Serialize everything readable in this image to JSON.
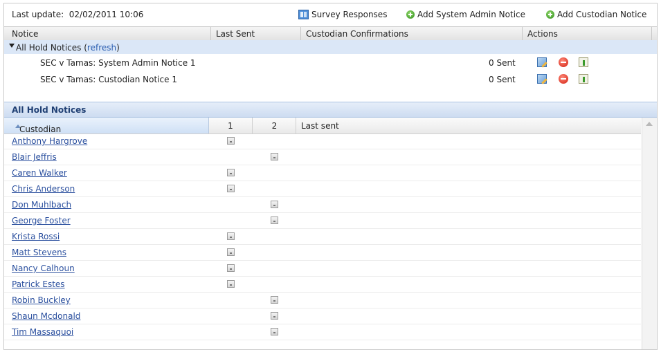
{
  "topbar": {
    "last_update_label": "Last update:",
    "last_update_value": "02/02/2011 10:06",
    "survey_responses": "Survey Responses",
    "add_system_admin_notice": "Add System Admin Notice",
    "add_custodian_notice": "Add Custodian Notice"
  },
  "notices_table": {
    "columns": [
      "Notice",
      "Last Sent",
      "Custodian Confirmations",
      "Actions"
    ],
    "group": {
      "label": "All Hold Notices",
      "refresh": "refresh"
    },
    "rows": [
      {
        "title": "SEC v Tamas: System Admin Notice 1",
        "sent": "0 Sent"
      },
      {
        "title": "SEC v Tamas: Custodian Notice 1",
        "sent": "0 Sent"
      }
    ]
  },
  "hold_panel": {
    "title": "All Hold Notices",
    "columns": {
      "custodian": "Custodian",
      "col1": "1",
      "col2": "2",
      "last_sent": "Last sent"
    },
    "rows": [
      {
        "name": "Anthony Hargrove",
        "notice": 1
      },
      {
        "name": "Blair Jeffris",
        "notice": 2
      },
      {
        "name": "Caren Walker",
        "notice": 1
      },
      {
        "name": "Chris Anderson",
        "notice": 1
      },
      {
        "name": "Don Muhlbach",
        "notice": 2
      },
      {
        "name": "George Foster",
        "notice": 2
      },
      {
        "name": "Krista Rossi",
        "notice": 1
      },
      {
        "name": "Matt Stevens",
        "notice": 1
      },
      {
        "name": "Nancy Calhoun",
        "notice": 1
      },
      {
        "name": "Patrick Estes",
        "notice": 1
      },
      {
        "name": "Robin Buckley",
        "notice": 2
      },
      {
        "name": "Shaun Mcdonald",
        "notice": 2
      },
      {
        "name": "Tim Massaquoi",
        "notice": 2
      }
    ]
  }
}
